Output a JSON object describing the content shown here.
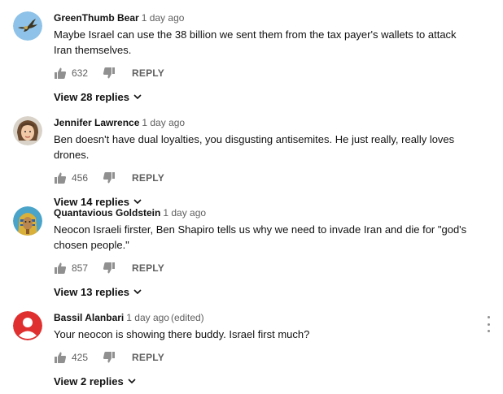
{
  "comments": [
    {
      "author": "GreenThumb Bear",
      "time": "1 day ago",
      "edited": "",
      "text": "Maybe Israel can use the 38 billion we sent them from the tax payer's wallets to attack Iran themselves.",
      "likes": "632",
      "reply_label": "REPLY",
      "view_replies": "View 28 replies",
      "avatar_icon": "bird-avatar-icon"
    },
    {
      "author": "Jennifer Lawrence",
      "time": "1 day ago",
      "edited": "",
      "text": "Ben doesn't have dual loyalties, you disgusting antisemites. He just really, really loves drones.",
      "likes": "456",
      "reply_label": "REPLY",
      "view_replies": "View 14 replies",
      "avatar_icon": "person-photo-avatar-icon"
    },
    {
      "author": "Quantavious Goldstein",
      "time": "1 day ago",
      "edited": "",
      "text": "Neocon Israeli firster, Ben Shapiro tells us why we need to invade Iran and die for \"god's chosen people.\"",
      "likes": "857",
      "reply_label": "REPLY",
      "view_replies": "View 13 replies",
      "avatar_icon": "pharaoh-avatar-icon"
    },
    {
      "author": "Bassil Alanbari",
      "time": "1 day ago",
      "edited": "(edited)",
      "text": "Your neocon is showing there buddy. Israel first much?",
      "likes": "425",
      "reply_label": "REPLY",
      "view_replies": "View 2 replies",
      "avatar_icon": "default-user-avatar-icon"
    }
  ],
  "colors": {
    "author": "#111111",
    "secondary_text": "#606060",
    "default_avatar_bg": "#e02f2f"
  }
}
